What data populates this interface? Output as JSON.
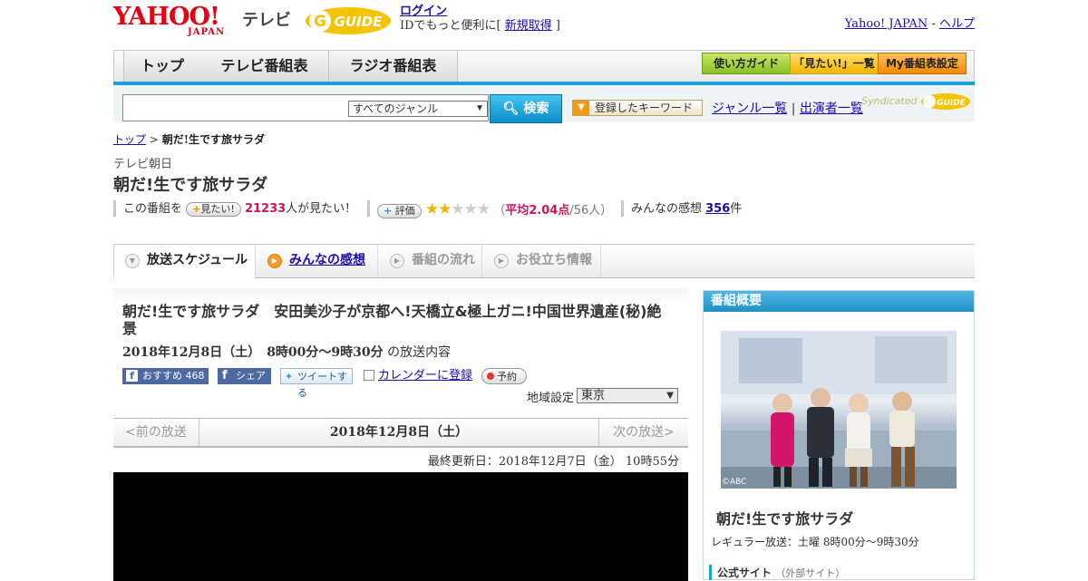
{
  "header": {
    "yahoo_logo": "YAHOO!",
    "yahoo_sub": "JAPAN",
    "tv_label": "テレビ",
    "gguide_logo": "G-GUIDE",
    "login_label": "ログイン",
    "id_text_prefix": "IDでもっと便利に[ ",
    "signup_label": "新規取得",
    "id_text_suffix": " ]",
    "yahoo_japan_link": "Yahoo! JAPAN",
    "separator": " - ",
    "help_link": "ヘルプ"
  },
  "nav": {
    "tabs": [
      "トップ",
      "テレビ番組表",
      "ラジオ番組表"
    ],
    "buttons": [
      "使い方ガイド",
      "「見たい!」一覧",
      "My番組表設定"
    ]
  },
  "search": {
    "genre_selected": "すべてのジャンル",
    "search_button": "検索",
    "keyword_button": "登録したキーワード",
    "genre_list_link": "ジャンル一覧",
    "divider": " | ",
    "cast_list_link": "出演者一覧",
    "syndicated": "Syndicated"
  },
  "breadcrumb": {
    "home": "トップ",
    "sep": " > ",
    "current": "朝だ!生です旅サラダ"
  },
  "program": {
    "channel": "テレビ朝日",
    "title": "朝だ!生です旅サラダ"
  },
  "rating": {
    "want_prefix": "この番組を",
    "want_button": "見たい!",
    "want_count": "21233",
    "want_suffix": "人が見たい！",
    "eval_button": "評価",
    "stars_on": 2,
    "stars_total": 5,
    "avg_prefix": "（",
    "avg_value": "平均2.04点",
    "avg_suffix": "/56人）",
    "comments_prefix": "みんなの感想 ",
    "comments_count": "356",
    "comments_suffix": "件"
  },
  "tabs": [
    "放送スケジュール",
    "みんなの感想",
    "番組の流れ",
    "お役立ち情報"
  ],
  "episode": {
    "title": "朝だ!生です旅サラダ　安田美沙子が京都へ!天橋立&極上ガニ!中国世界遺産(秘)絶景",
    "date": "2018年12月8日（土）　8時00分～9時30分",
    "date_suffix": " の放送内容",
    "fb_recommend": "おすすめ 468",
    "fb_share": "シェア",
    "tweet": "ツイートする",
    "calendar": "カレンダーに登録",
    "reserve": "予約",
    "region_label": "地域設定",
    "region_value": "東京"
  },
  "pager": {
    "prev": "<前の放送",
    "current": "2018年12月8日（土）",
    "next": "次の放送>"
  },
  "updated": "最終更新日：2018年12月7日（金）  10時55分",
  "sidebar": {
    "heading": "番組概要",
    "image_credit": "©ABC",
    "title": "朝だ!生です旅サラダ",
    "schedule": "レギュラー放送：土曜 8時00分～9時30分",
    "official_site": "公式サイト",
    "external": "（外部サイト）"
  },
  "colors": {
    "accent_blue": "#1aa0d8",
    "brand_red": "#e60012",
    "highlight_pink": "#d4145a",
    "star": "#f0b400"
  }
}
